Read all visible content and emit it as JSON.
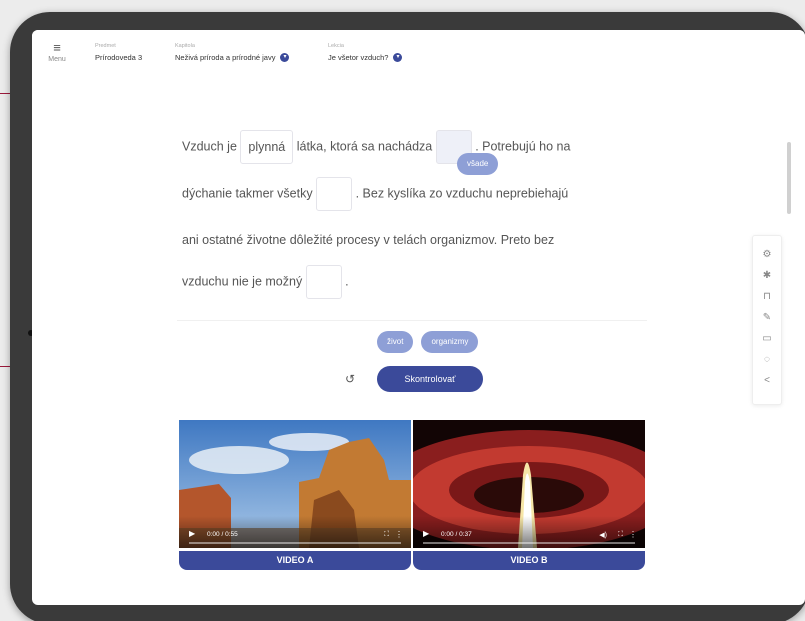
{
  "menu": {
    "icon": "hamburger-icon",
    "label": "Menu"
  },
  "breadcrumbs": [
    {
      "caption": "Predmet",
      "value": "Prírodoveda 3",
      "has_dropdown": false
    },
    {
      "caption": "Kapitola",
      "value": "Neživá príroda a prírodné javy",
      "has_dropdown": true
    },
    {
      "caption": "Lekcia",
      "value": "Je všetor vzduch?",
      "has_dropdown": true
    }
  ],
  "exercise": {
    "line1": {
      "a": "Vzduch je",
      "gap1": "plynná",
      "b": "látka, ktorá sa nachádza",
      "c": ". Potrebujú ho na"
    },
    "line2": {
      "a": "dýchanie takmer všetky",
      "b": ". Bez kyslíka zo vzduchu neprebiehajú"
    },
    "line3": {
      "a": "ani ostatné životne dôležité procesy v telách organizmov. Preto bez"
    },
    "line4": {
      "a": "vzduchu nie je možný",
      "b": "."
    },
    "floating_chip": "všade"
  },
  "answer_chips": [
    "život",
    "organizmy"
  ],
  "controls": {
    "reset_icon": "reset-icon",
    "check_label": "Skontrolovať"
  },
  "toolbar": [
    "gear-icon",
    "accessibility-icon",
    "bookmark-icon",
    "pencil-icon",
    "screen-icon",
    "target-icon",
    "share-icon"
  ],
  "videos": [
    {
      "label": "VIDEO A",
      "time": "0:00 / 0:55",
      "scene": "desert-rock-formation"
    },
    {
      "label": "VIDEO B",
      "time": "0:00 / 0:37",
      "scene": "hot-air-balloon-flame"
    }
  ],
  "colors": {
    "accent": "#3b4a9a",
    "chip": "#8e9fd6",
    "callout": "#9c1a3c"
  }
}
